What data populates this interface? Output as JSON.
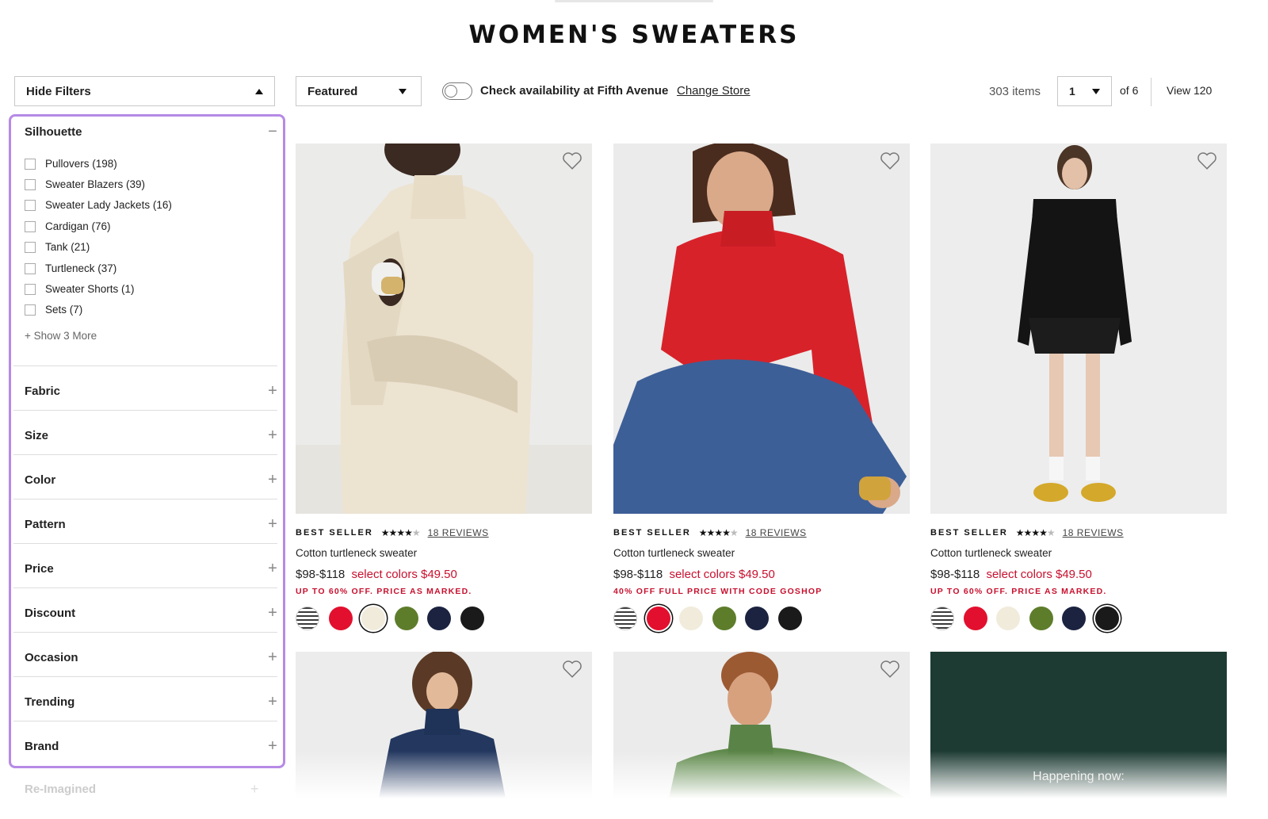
{
  "page": {
    "title": "WOMEN'S SWEATERS"
  },
  "toolbar": {
    "hide_filters": "Hide Filters",
    "sort_value": "Featured",
    "availability_text": "Check availability at Fifth Avenue",
    "change_store": "Change Store",
    "items_count": "303 items",
    "page_value": "1",
    "of_pages": "of 6",
    "view_all": "View 120"
  },
  "filters": {
    "silhouette": {
      "title": "Silhouette",
      "options": [
        "Pullovers (198)",
        "Sweater Blazers (39)",
        "Sweater Lady Jackets (16)",
        "Cardigan (76)",
        "Tank (21)",
        "Turtleneck (37)",
        "Sweater Shorts (1)",
        "Sets (7)"
      ],
      "show_more": "+ Show 3 More"
    },
    "groups": [
      "Fabric",
      "Size",
      "Color",
      "Pattern",
      "Price",
      "Discount",
      "Occasion",
      "Trending",
      "Brand"
    ],
    "next_group": "Re-Imagined"
  },
  "products": [
    {
      "badge": "BEST SELLER",
      "stars": "★★★★",
      "star_dim": "★",
      "reviews": "18 REVIEWS",
      "name": "Cotton turtleneck sweater",
      "price": "$98-$118",
      "sale": "select colors $49.50",
      "promo": "UP TO 60% OFF. PRICE AS MARKED."
    },
    {
      "badge": "BEST SELLER",
      "stars": "★★★★",
      "star_dim": "★",
      "reviews": "18 REVIEWS",
      "name": "Cotton turtleneck sweater",
      "price": "$98-$118",
      "sale": "select colors $49.50",
      "promo": "40% OFF FULL PRICE WITH CODE GOSHOP"
    },
    {
      "badge": "BEST SELLER",
      "stars": "★★★★",
      "star_dim": "★",
      "reviews": "18 REVIEWS",
      "name": "Cotton turtleneck sweater",
      "price": "$98-$118",
      "sale": "select colors $49.50",
      "promo": "UP TO 60% OFF. PRICE AS MARKED."
    }
  ],
  "swatch_colors": [
    "#e2102e",
    "#f1ebdc",
    "#5e7d2b",
    "#1b2340",
    "#1a1a1a"
  ],
  "promo_tile": {
    "text": "Happening now:"
  },
  "colors": {
    "accent_sale": "#c8102e",
    "panel_highlight": "#b68ae6",
    "promo_bg": "#1d3b33"
  }
}
